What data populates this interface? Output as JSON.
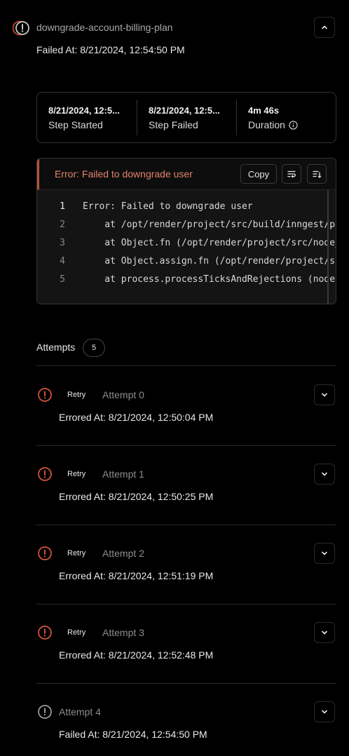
{
  "header": {
    "step_name": "downgrade-account-billing-plan",
    "failed_at": "Failed At: 8/21/2024, 12:54:50 PM"
  },
  "stats": [
    {
      "value": "8/21/2024, 12:5...",
      "label": "Step Started"
    },
    {
      "value": "8/21/2024, 12:5...",
      "label": "Step Failed"
    },
    {
      "value": "4m 46s",
      "label": "Duration"
    }
  ],
  "error": {
    "message": "Error: Failed to downgrade user",
    "copy_label": "Copy",
    "lines": [
      {
        "n": "1",
        "text": "Error: Failed to downgrade user"
      },
      {
        "n": "2",
        "text": "    at /opt/render/project/src/build/inngest/pa"
      },
      {
        "n": "3",
        "text": "    at Object.fn (/opt/render/project/src/node_"
      },
      {
        "n": "4",
        "text": "    at Object.assign.fn (/opt/render/project/sı"
      },
      {
        "n": "5",
        "text": "    at process.processTicksAndRejections (node"
      }
    ]
  },
  "attempts": {
    "label": "Attempts",
    "count": "5",
    "items": [
      {
        "retry": "Retry",
        "name": "Attempt 0",
        "time": "Errored At: 8/21/2024, 12:50:04 PM"
      },
      {
        "retry": "Retry",
        "name": "Attempt 1",
        "time": "Errored At: 8/21/2024, 12:50:25 PM"
      },
      {
        "retry": "Retry",
        "name": "Attempt 2",
        "time": "Errored At: 8/21/2024, 12:51:19 PM"
      },
      {
        "retry": "Retry",
        "name": "Attempt 3",
        "time": "Errored At: 8/21/2024, 12:52:48 PM"
      },
      {
        "retry": "",
        "name": "Attempt 4",
        "time": "Failed At: 8/21/2024, 12:54:50 PM"
      }
    ]
  },
  "colors": {
    "error_red": "#d4533a",
    "failed_gray": "#9a9a9a",
    "error_text": "#e2836a"
  }
}
